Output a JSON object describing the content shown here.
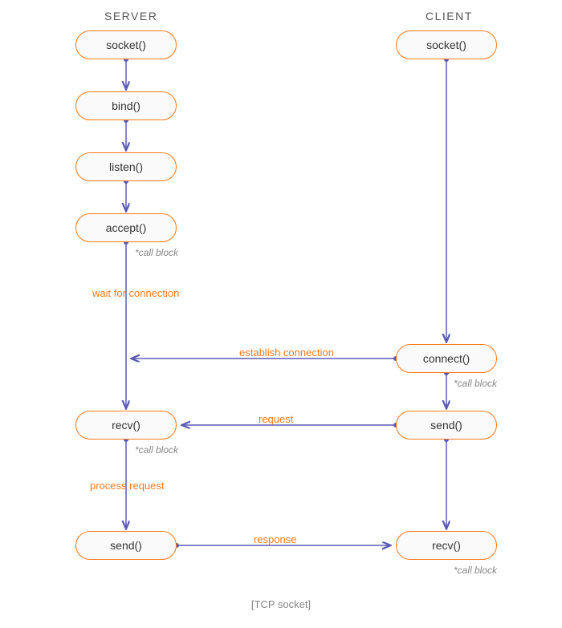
{
  "titles": {
    "server": "SERVER",
    "client": "CLIENT"
  },
  "nodes": {
    "server_socket": "socket()",
    "server_bind": "bind()",
    "server_listen": "listen()",
    "server_accept": "accept()",
    "server_recv": "recv()",
    "server_send": "send()",
    "client_socket": "socket()",
    "client_connect": "connect()",
    "client_send": "send()",
    "client_recv": "recv()"
  },
  "annotations": {
    "accept_block": "call block",
    "recv_block": "call block",
    "connect_block": "call block",
    "client_recv_block": "call block"
  },
  "labels": {
    "wait_for_connection": "wait for connection",
    "establish_connection": "establish connection",
    "request": "request",
    "process_request": "process request",
    "response": "response"
  },
  "caption": "[TCP socket]",
  "colors": {
    "node_border": "#ff7a1a",
    "connector": "#5a5ab5",
    "label": "#ff7a1a"
  }
}
